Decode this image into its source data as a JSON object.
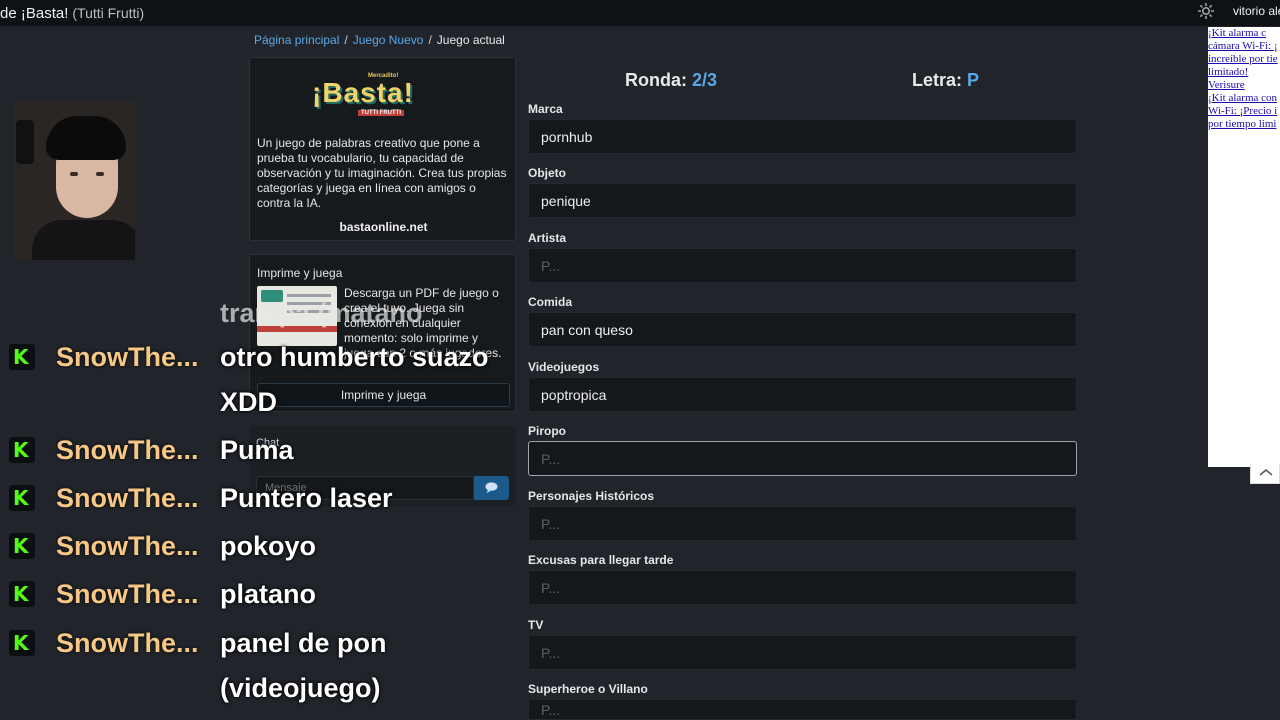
{
  "window": {
    "title": "de ¡Basta!",
    "subtitle": "(Tutti Frutti)",
    "user": "vitorio ale"
  },
  "breadcrumb": {
    "home": "Página principal",
    "sep1": "/",
    "new_game": "Juego Nuevo",
    "sep2": "/",
    "current": "Juego actual"
  },
  "info_card": {
    "logo_small": "Mercadito!",
    "logo_main": "¡Basta!",
    "logo_tag": "TUTTI FRUTTI",
    "description": "Un juego de palabras creativo que pone a prueba tu vocabulario, tu capacidad de observación y tu imaginación. Crea tus propias categorías y juega en línea con amigos o contra la IA.",
    "site": "bastaonline.net"
  },
  "print_card": {
    "heading": "Imprime y juega",
    "text": "Descarga un PDF de juego o crea el tuyo. Juega sin conexión en cualquier momento: solo imprime y juega con 2 o más jugadores.",
    "button": "Imprime y juega"
  },
  "chat_card": {
    "label": "Chat",
    "placeholder": "Mensaje"
  },
  "stream_chat": {
    "faded_line": "trampa (matano",
    "messages": [
      {
        "user": "SnowThe...",
        "text": "otro humberto suazo"
      },
      {
        "user": "",
        "text": "XDD"
      },
      {
        "user": "SnowThe...",
        "text": "Puma"
      },
      {
        "user": "SnowThe...",
        "text": "Puntero laser"
      },
      {
        "user": "SnowThe...",
        "text": "pokoyo"
      },
      {
        "user": "SnowThe...",
        "text": "platano"
      },
      {
        "user": "SnowThe...",
        "text": "panel de pon"
      },
      {
        "user": "",
        "text": "(videojuego)"
      }
    ],
    "badge_letter": "K"
  },
  "game": {
    "round_label": "Ronda:",
    "round_value": "2/3",
    "letter_label": "Letra:",
    "letter_value": "P",
    "placeholder": "P...",
    "fields": [
      {
        "label": "Marca",
        "value": "pornhub"
      },
      {
        "label": "Objeto",
        "value": "penique"
      },
      {
        "label": "Artista",
        "value": ""
      },
      {
        "label": "Comida",
        "value": "pan con queso"
      },
      {
        "label": "Videojuegos",
        "value": "poptropica"
      },
      {
        "label": "Piropo",
        "value": ""
      },
      {
        "label": "Personajes Históricos",
        "value": ""
      },
      {
        "label": "Excusas para llegar tarde",
        "value": ""
      },
      {
        "label": "TV",
        "value": ""
      },
      {
        "label": "Superheroe o Villano",
        "value": ""
      }
    ]
  },
  "ad": {
    "lines": [
      "¡Kit alarma c",
      "cámara Wi-Fi: ¡",
      "increíble por tie",
      "limitado!",
      "Verisure",
      "¡Kit alarma con",
      "Wi-Fi: ¡Precio i",
      "por tiempo limi"
    ]
  },
  "colors": {
    "accent": "#59a8e8",
    "kick_green": "#53fc18",
    "username": "#f5c886",
    "background": "#21252b"
  }
}
